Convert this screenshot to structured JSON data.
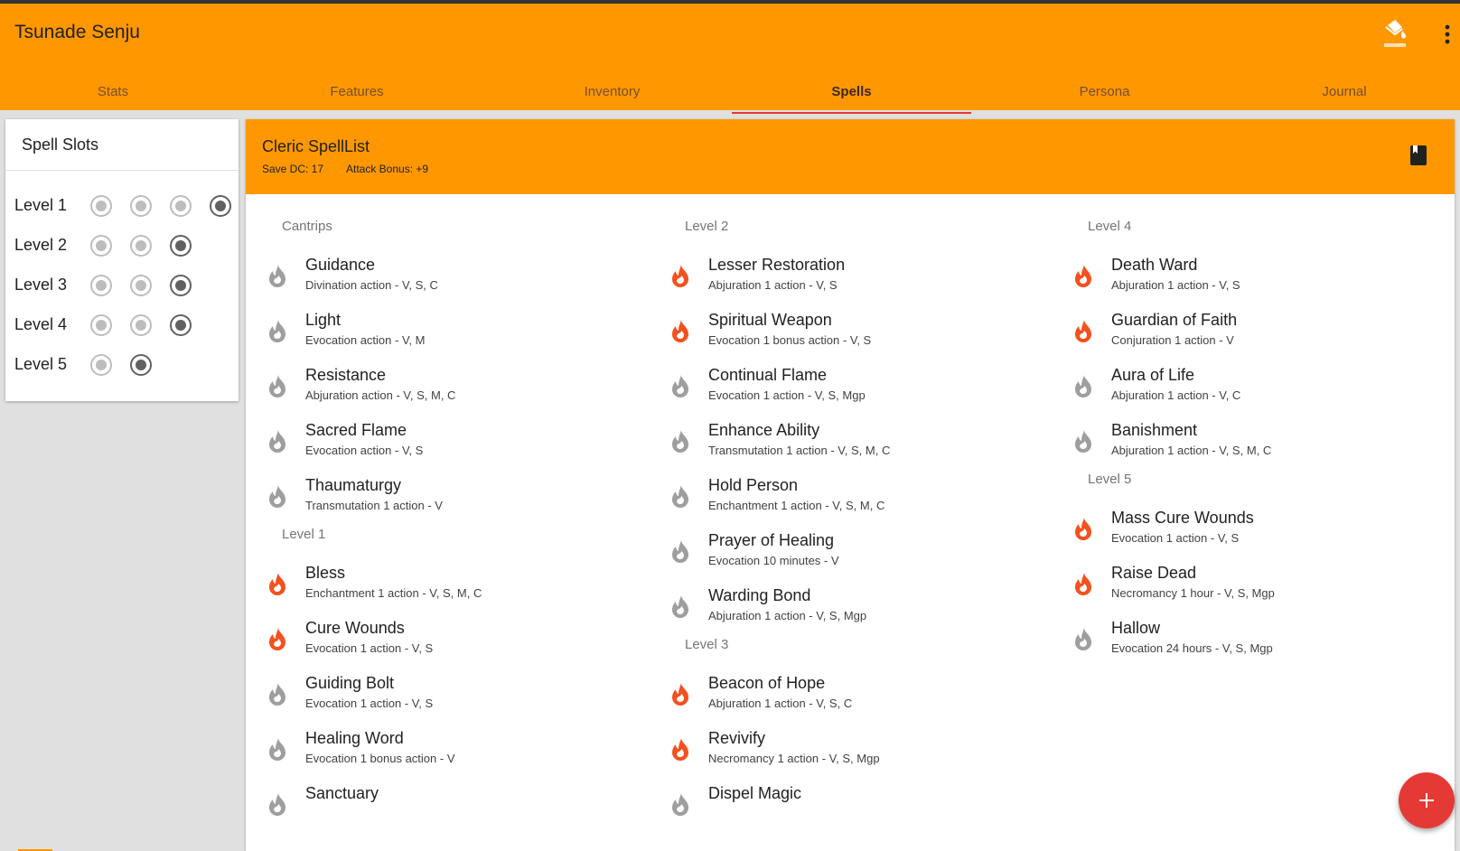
{
  "app": {
    "title": "Tsunade Senju"
  },
  "colors": {
    "primary": "#ff9800",
    "accent": "#e53935",
    "flame_active": "#f4511e",
    "flame_inactive": "#9e9e9e"
  },
  "toolbar": {
    "paint_icon": "format-paint-icon",
    "more_icon": "more-vert-icon"
  },
  "tabs": [
    {
      "label": "Stats",
      "active": false
    },
    {
      "label": "Features",
      "active": false
    },
    {
      "label": "Inventory",
      "active": false
    },
    {
      "label": "Spells",
      "active": true
    },
    {
      "label": "Persona",
      "active": false
    },
    {
      "label": "Journal",
      "active": false
    }
  ],
  "spell_slots": {
    "title": "Spell Slots",
    "levels": [
      {
        "label": "Level 1",
        "slots": 4
      },
      {
        "label": "Level 2",
        "slots": 3
      },
      {
        "label": "Level 3",
        "slots": 3
      },
      {
        "label": "Level 4",
        "slots": 3
      },
      {
        "label": "Level 5",
        "slots": 2
      }
    ]
  },
  "spell_list": {
    "title": "Cleric SpellList",
    "save_dc": "Save DC: 17",
    "attack_bonus": "Attack Bonus: +9",
    "book_icon": "book-icon",
    "columns": [
      {
        "sections": [
          {
            "heading": "Cantrips",
            "spells": [
              {
                "name": "Guidance",
                "meta": "Divination action - V, S, C",
                "prepared": false
              },
              {
                "name": "Light",
                "meta": "Evocation action - V, M",
                "prepared": false
              },
              {
                "name": "Resistance",
                "meta": "Abjuration action - V, S, M, C",
                "prepared": false
              },
              {
                "name": "Sacred Flame",
                "meta": "Evocation action - V, S",
                "prepared": false
              },
              {
                "name": "Thaumaturgy",
                "meta": "Transmutation 1 action - V",
                "prepared": false
              }
            ]
          },
          {
            "heading": "Level 1",
            "spells": [
              {
                "name": "Bless",
                "meta": "Enchantment 1 action - V, S, M, C",
                "prepared": true
              },
              {
                "name": "Cure Wounds",
                "meta": "Evocation 1 action - V, S",
                "prepared": true
              },
              {
                "name": "Guiding Bolt",
                "meta": "Evocation 1 action - V, S",
                "prepared": false
              },
              {
                "name": "Healing Word",
                "meta": "Evocation 1 bonus action - V",
                "prepared": false
              },
              {
                "name": "Sanctuary",
                "meta": "",
                "prepared": false
              }
            ]
          }
        ]
      },
      {
        "sections": [
          {
            "heading": "Level 2",
            "spells": [
              {
                "name": "Lesser Restoration",
                "meta": "Abjuration 1 action - V, S",
                "prepared": true
              },
              {
                "name": "Spiritual Weapon",
                "meta": "Evocation 1 bonus action - V, S",
                "prepared": true
              },
              {
                "name": "Continual Flame",
                "meta": "Evocation 1 action - V, S, Mgp",
                "prepared": false
              },
              {
                "name": "Enhance Ability",
                "meta": "Transmutation 1 action - V, S, M, C",
                "prepared": false
              },
              {
                "name": "Hold Person",
                "meta": "Enchantment 1 action - V, S, M, C",
                "prepared": false
              },
              {
                "name": "Prayer of Healing",
                "meta": "Evocation 10 minutes - V",
                "prepared": false
              },
              {
                "name": "Warding Bond",
                "meta": "Abjuration 1 action - V, S, Mgp",
                "prepared": false
              }
            ]
          },
          {
            "heading": "Level 3",
            "spells": [
              {
                "name": "Beacon of Hope",
                "meta": "Abjuration 1 action - V, S, C",
                "prepared": true
              },
              {
                "name": "Revivify",
                "meta": "Necromancy 1 action - V, S, Mgp",
                "prepared": true
              },
              {
                "name": "Dispel Magic",
                "meta": "",
                "prepared": false
              }
            ]
          }
        ]
      },
      {
        "sections": [
          {
            "heading": "Level 4",
            "spells": [
              {
                "name": "Death Ward",
                "meta": "Abjuration 1 action - V, S",
                "prepared": true
              },
              {
                "name": "Guardian of Faith",
                "meta": "Conjuration 1 action - V",
                "prepared": true
              },
              {
                "name": "Aura of Life",
                "meta": "Abjuration 1 action - V, C",
                "prepared": false
              },
              {
                "name": "Banishment",
                "meta": "Abjuration 1 action - V, S, M, C",
                "prepared": false
              }
            ]
          },
          {
            "heading": "Level 5",
            "spells": [
              {
                "name": "Mass Cure Wounds",
                "meta": "Evocation 1 action - V, S",
                "prepared": true
              },
              {
                "name": "Raise Dead",
                "meta": "Necromancy 1 hour - V, S, Mgp",
                "prepared": true
              },
              {
                "name": "Hallow",
                "meta": "Evocation 24 hours - V, S, Mgp",
                "prepared": false
              }
            ]
          }
        ]
      }
    ]
  },
  "fab": {
    "icon": "add-icon"
  }
}
